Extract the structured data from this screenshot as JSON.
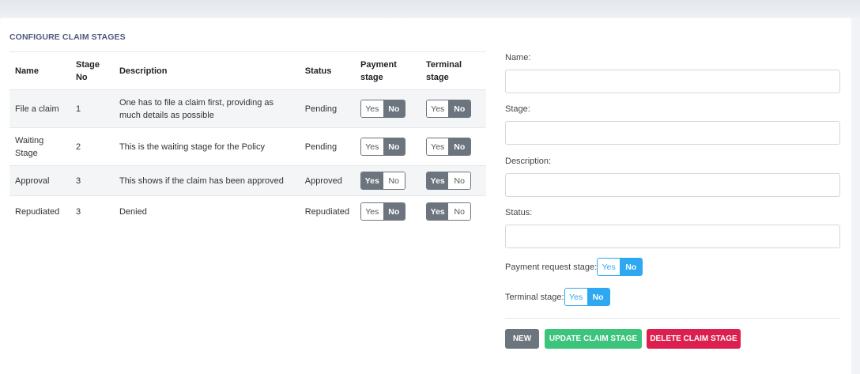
{
  "section_title": "CONFIGURE CLAIM STAGES",
  "table": {
    "headers": {
      "name": "Name",
      "stage_no_1": "Stage",
      "stage_no_2": "No",
      "description": "Description",
      "status": "Status",
      "payment_1": "Payment",
      "payment_2": "stage",
      "terminal_1": "Terminal",
      "terminal_2": "stage"
    },
    "rows": [
      {
        "name_1": "File a claim",
        "name_2": "",
        "stage_no": "1",
        "description_1": "One has to file a claim first, providing as",
        "description_2": "much details as possible",
        "status": "Pending",
        "payment": {
          "yes": "Yes",
          "no": "No",
          "selected": "No"
        },
        "terminal": {
          "yes": "Yes",
          "no": "No",
          "selected": "No"
        }
      },
      {
        "name_1": "Waiting",
        "name_2": "Stage",
        "stage_no": "2",
        "description_1": "This is the waiting stage for the Policy",
        "description_2": "",
        "status": "Pending",
        "payment": {
          "yes": "Yes",
          "no": "No",
          "selected": "No"
        },
        "terminal": {
          "yes": "Yes",
          "no": "No",
          "selected": "No"
        }
      },
      {
        "name_1": "Approval",
        "name_2": "",
        "stage_no": "3",
        "description_1": "This shows if the claim has been approved",
        "description_2": "",
        "status": "Approved",
        "payment": {
          "yes": "Yes",
          "no": "No",
          "selected": "Yes"
        },
        "terminal": {
          "yes": "Yes",
          "no": "No",
          "selected": "Yes"
        }
      },
      {
        "name_1": "Repudiated",
        "name_2": "",
        "stage_no": "3",
        "description_1": "Denied",
        "description_2": "",
        "status": "Repudiated",
        "payment": {
          "yes": "Yes",
          "no": "No",
          "selected": "No"
        },
        "terminal": {
          "yes": "Yes",
          "no": "No",
          "selected": "Yes"
        }
      }
    ]
  },
  "form": {
    "name_label": "Name:",
    "name_value": "",
    "stage_label": "Stage:",
    "stage_value": "",
    "description_label": "Description:",
    "description_value": "",
    "status_label": "Status:",
    "status_value": "",
    "payment_request_label": "Payment request stage:",
    "payment_request_toggle": {
      "yes": "Yes",
      "no": "No",
      "selected": "No"
    },
    "terminal_label": "Terminal stage:",
    "terminal_toggle": {
      "yes": "Yes",
      "no": "No",
      "selected": "No"
    }
  },
  "buttons": {
    "new": "NEW",
    "update": "UPDATE CLAIM STAGE",
    "delete": "DELETE CLAIM STAGE"
  },
  "colors": {
    "toggle_on": "#6c757d",
    "toggle_blue": "#2ea8f0",
    "btn_new": "#6c757d",
    "btn_update": "#3cc47c",
    "btn_delete": "#dc1f4e"
  }
}
